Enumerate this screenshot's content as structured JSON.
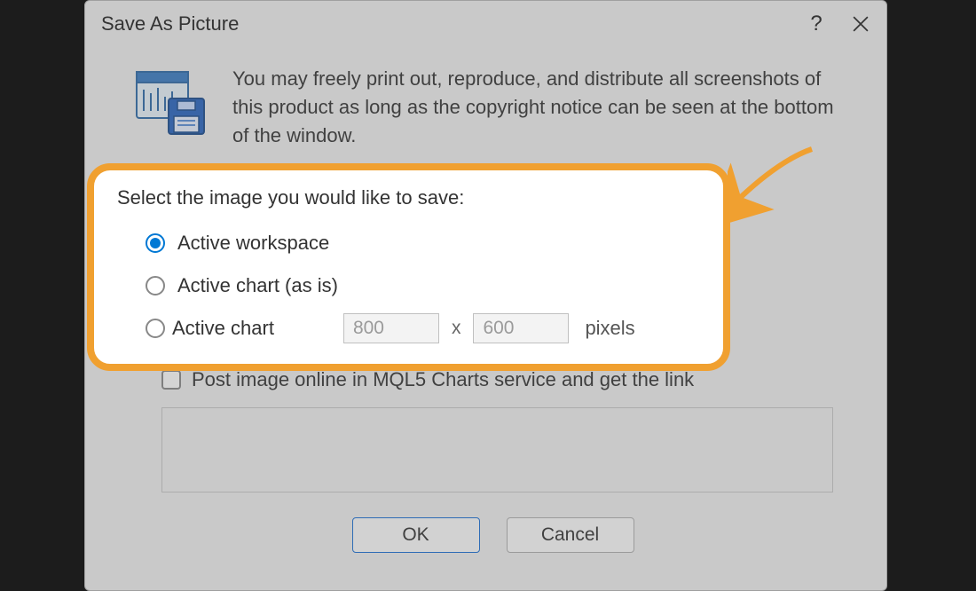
{
  "dialog": {
    "title": "Save As Picture",
    "intro": "You may freely print out, reproduce, and distribute all screenshots of this product as long as the copyright notice can be seen at the bottom of the window.",
    "select_label": "Select the image you would like to save:",
    "options": {
      "workspace": "Active workspace",
      "chart_asis": "Active chart (as is)",
      "chart": "Active chart"
    },
    "width": "800",
    "height": "600",
    "x": "x",
    "pixels_label": "pixels",
    "checkbox_label": "Post image online in MQL5 Charts service and get the link",
    "buttons": {
      "ok": "OK",
      "cancel": "Cancel"
    },
    "help": "?"
  }
}
